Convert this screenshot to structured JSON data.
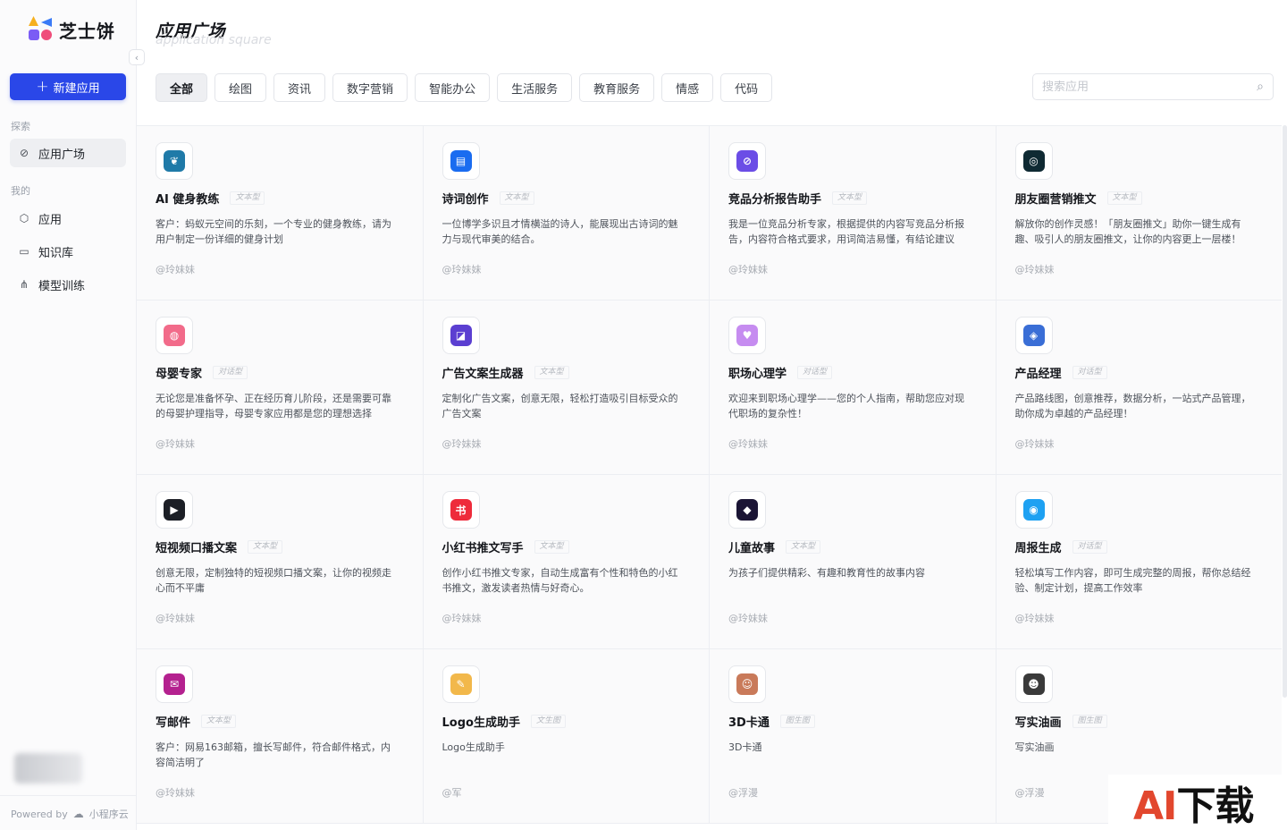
{
  "brand": {
    "name": "芝士饼"
  },
  "sidebar": {
    "new_app_label": "新建应用",
    "sections": [
      {
        "label": "探索",
        "items": [
          {
            "label": "应用广场",
            "icon": "compass-icon"
          }
        ]
      },
      {
        "label": "我的",
        "items": [
          {
            "label": "应用",
            "icon": "cube-icon"
          },
          {
            "label": "知识库",
            "icon": "folder-icon"
          },
          {
            "label": "模型训练",
            "icon": "network-icon"
          }
        ]
      }
    ],
    "footer": {
      "powered_by": "Powered by",
      "vendor": "小程序云"
    }
  },
  "header": {
    "title": "应用广场",
    "subtitle": "application square"
  },
  "filters": [
    "全部",
    "绘图",
    "资讯",
    "数字营销",
    "智能办公",
    "生活服务",
    "教育服务",
    "情感",
    "代码"
  ],
  "search": {
    "placeholder": "搜索应用"
  },
  "apps": [
    {
      "title": "AI 健身教练",
      "tag": "文本型",
      "desc": "客户：蚂蚁元空间的乐刻，一个专业的健身教练，请为用户制定一份详细的健身计划",
      "author": "@玲妹妹",
      "icon_color": "#1f7aa8",
      "icon_glyph": "❦"
    },
    {
      "title": "诗词创作",
      "tag": "文本型",
      "desc": "一位博学多识且才情横溢的诗人，能展现出古诗词的魅力与现代审美的结合。",
      "author": "@玲妹妹",
      "icon_color": "#1a6cf0",
      "icon_glyph": "▤"
    },
    {
      "title": "竞品分析报告助手",
      "tag": "文本型",
      "desc": "我是一位竞品分析专家，根据提供的内容写竞品分析报告，内容符合格式要求，用词简洁易懂，有结论建议",
      "author": "@玲妹妹",
      "icon_color": "#6b4de6",
      "icon_glyph": "⊘"
    },
    {
      "title": "朋友圈营销推文",
      "tag": "文本型",
      "desc": "解放你的创作灵感！「朋友圈推文」助你一键生成有趣、吸引人的朋友圈推文，让你的内容更上一层楼！",
      "author": "@玲妹妹",
      "icon_color": "#0f2a33",
      "icon_glyph": "◎"
    },
    {
      "title": "母婴专家",
      "tag": "对话型",
      "desc": "无论您是准备怀孕、正在经历育儿阶段，还是需要可靠的母婴护理指导，母婴专家应用都是您的理想选择",
      "author": "@玲妹妹",
      "icon_color": "#f26b8a",
      "icon_glyph": "◍"
    },
    {
      "title": "广告文案生成器",
      "tag": "文本型",
      "desc": "定制化广告文案，创意无限，轻松打造吸引目标受众的广告文案",
      "author": "@玲妹妹",
      "icon_color": "#5b3fd1",
      "icon_glyph": "◪"
    },
    {
      "title": "职场心理学",
      "tag": "对话型",
      "desc": "欢迎来到职场心理学——您的个人指南，帮助您应对现代职场的复杂性！",
      "author": "@玲妹妹",
      "icon_color": "#c68cf0",
      "icon_glyph": "♥"
    },
    {
      "title": "产品经理",
      "tag": "对话型",
      "desc": "产品路线图，创意推荐，数据分析，一站式产品管理，助你成为卓越的产品经理！",
      "author": "@玲妹妹",
      "icon_color": "#3a6ed6",
      "icon_glyph": "◈"
    },
    {
      "title": "短视频口播文案",
      "tag": "文本型",
      "desc": "创意无限，定制独特的短视频口播文案，让你的视频走心而不平庸",
      "author": "@玲妹妹",
      "icon_color": "#1c1f26",
      "icon_glyph": "▶"
    },
    {
      "title": "小红书推文写手",
      "tag": "文本型",
      "desc": "创作小红书推文专家，自动生成富有个性和特色的小红书推文，激发读者热情与好奇心。",
      "author": "@玲妹妹",
      "icon_color": "#ee2b3b",
      "icon_glyph": "书"
    },
    {
      "title": "儿童故事",
      "tag": "文本型",
      "desc": "为孩子们提供精彩、有趣和教育性的故事内容",
      "author": "@玲妹妹",
      "icon_color": "#1b1535",
      "icon_glyph": "◆"
    },
    {
      "title": "周报生成",
      "tag": "对话型",
      "desc": "轻松填写工作内容，即可生成完整的周报，帮你总结经验、制定计划，提高工作效率",
      "author": "@玲妹妹",
      "icon_color": "#1ea1f2",
      "icon_glyph": "◉"
    },
    {
      "title": "写邮件",
      "tag": "文本型",
      "desc": "客户：网易163邮箱，擅长写邮件，符合邮件格式，内容简洁明了",
      "author": "@玲妹妹",
      "icon_color": "#b4218f",
      "icon_glyph": "✉"
    },
    {
      "title": "Logo生成助手",
      "tag": "文生图",
      "desc": "Logo生成助手",
      "author": "@军",
      "icon_color": "#f2b84b",
      "icon_glyph": "✎"
    },
    {
      "title": "3D卡通",
      "tag": "图生图",
      "desc": "3D卡通",
      "author": "@浮漫",
      "icon_color": "#c97a5a",
      "icon_glyph": "☺"
    },
    {
      "title": "写实油画",
      "tag": "图生图",
      "desc": "写实油画",
      "author": "@浮漫",
      "icon_color": "#3a3a3a",
      "icon_glyph": "☻"
    }
  ],
  "watermark": {
    "prefix": "AI",
    "suffix": "下载"
  }
}
